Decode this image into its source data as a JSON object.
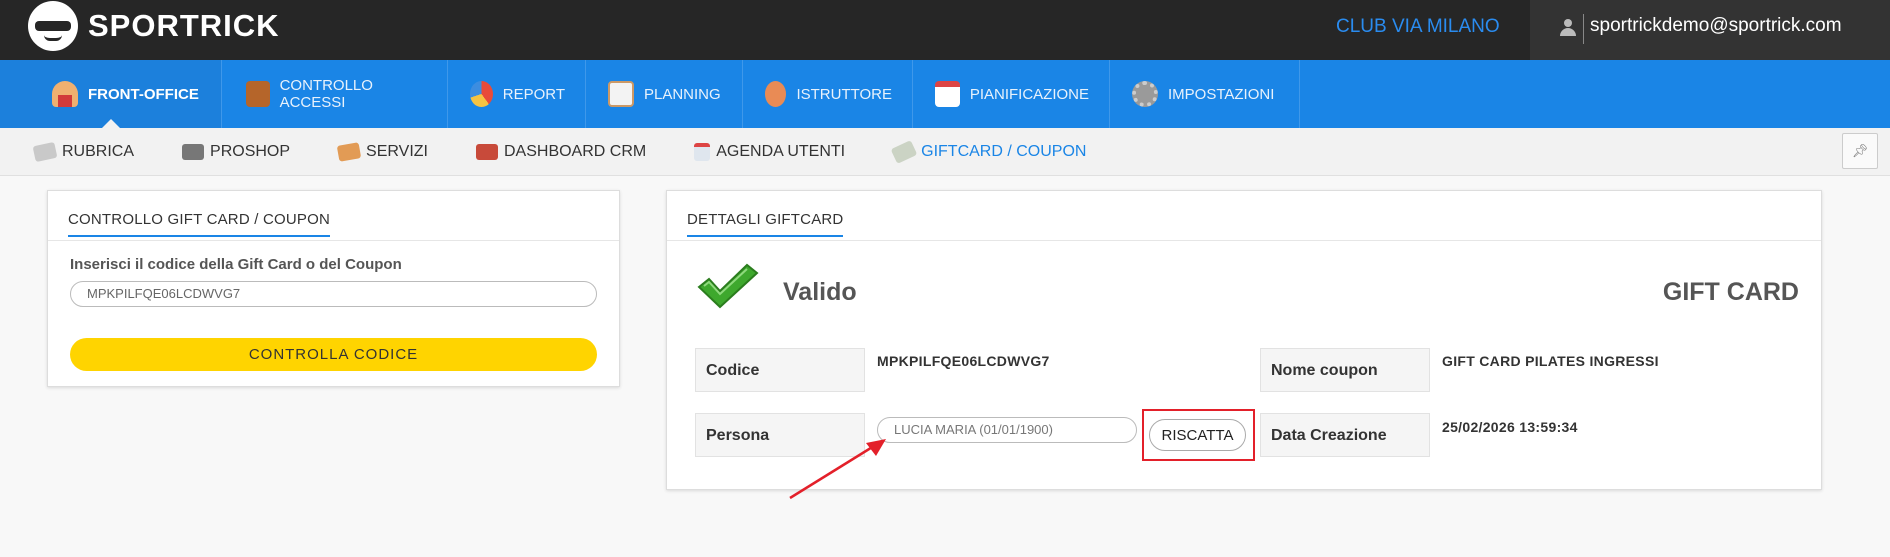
{
  "header": {
    "brand": "SPORTRICK",
    "club": "CLUB VIA MILANO",
    "user_email": "sportrickdemo@sportrick.com"
  },
  "main_nav": [
    {
      "label": "FRONT-OFFICE",
      "icon": "front-office-icon",
      "active": true
    },
    {
      "label": "CONTROLLO ACCESSI",
      "icon": "access-control-icon"
    },
    {
      "label": "REPORT",
      "icon": "pie-chart-icon"
    },
    {
      "label": "PLANNING",
      "icon": "planning-calendar-icon"
    },
    {
      "label": "ISTRUTTORE",
      "icon": "instructor-icon"
    },
    {
      "label": "PIANIFICAZIONE",
      "icon": "schedule-calendar-icon"
    },
    {
      "label": "IMPOSTAZIONI",
      "icon": "gear-icon"
    }
  ],
  "sub_nav": [
    {
      "label": "RUBRICA",
      "icon": "address-book-icon"
    },
    {
      "label": "PROSHOP",
      "icon": "cash-register-icon"
    },
    {
      "label": "SERVIZI",
      "icon": "services-icon"
    },
    {
      "label": "DASHBOARD CRM",
      "icon": "dashboard-icon"
    },
    {
      "label": "AGENDA UTENTI",
      "icon": "agenda-icon"
    },
    {
      "label": "GIFTCARD / COUPON",
      "icon": "giftcard-icon",
      "active": true
    }
  ],
  "check_panel": {
    "title": "CONTROLLO GIFT CARD / COUPON",
    "code_label": "Inserisci il codice della Gift Card o del Coupon",
    "code_value": "MPKPILFQE06LCDWVG7",
    "button_label": "CONTROLLA CODICE"
  },
  "details_panel": {
    "title": "DETTAGLI GIFTCARD",
    "status": "Valido",
    "type": "GIFT CARD",
    "codice_label": "Codice",
    "codice_value": "MPKPILFQE06LCDWVG7",
    "nome_coupon_label": "Nome coupon",
    "nome_coupon_value": "GIFT CARD PILATES INGRESSI",
    "persona_label": "Persona",
    "persona_value": "LUCIA MARIA (01/01/1900)",
    "riscatta_label": "RISCATTA",
    "data_creazione_label": "Data Creazione",
    "data_creazione_value": "25/02/2026 13:59:34"
  },
  "colors": {
    "topbar": "#262626",
    "nav_blue": "#1a85e6",
    "club_blue": "#2a8cf0",
    "button_yellow": "#ffd400",
    "highlight_red": "#e3202a",
    "check_green": "#3ea82d"
  }
}
